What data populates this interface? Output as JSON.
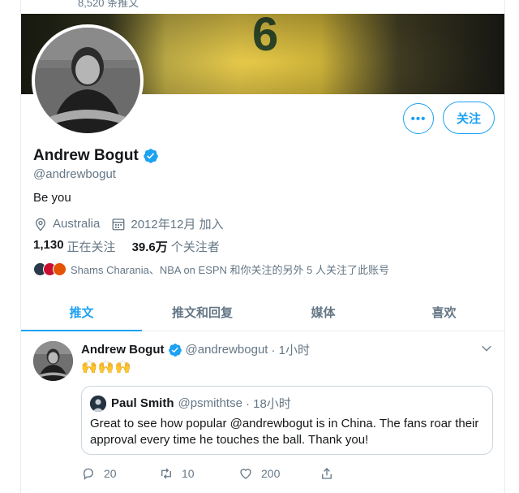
{
  "header": {
    "tweet_count": "8,520 条推文"
  },
  "profile": {
    "name": "Andrew Bogut",
    "handle": "@andrewbogut",
    "bio": "Be you",
    "location": "Australia",
    "joined": "2012年12月 加入",
    "jersey_number": "6",
    "more_button": "•••",
    "follow_button": "关注",
    "following_count": "1,130",
    "following_label": "正在关注",
    "followers_count": "39.6万",
    "followers_label": "个关注者",
    "followed_by_text": "Shams Charania、NBA on ESPN 和你关注的另外 5 人关注了此账号",
    "icons": [
      "verified-badge-icon",
      "location-pin-icon",
      "calendar-icon"
    ]
  },
  "tabs": [
    {
      "label": "推文",
      "active": true
    },
    {
      "label": "推文和回复",
      "active": false
    },
    {
      "label": "媒体",
      "active": false
    },
    {
      "label": "喜欢",
      "active": false
    }
  ],
  "tweet": {
    "author_name": "Andrew Bogut",
    "author_handle": "@andrewbogut",
    "time": "· 1小时",
    "text": "🙌🙌🙌",
    "quote": {
      "author_name": "Paul Smith",
      "author_handle": "@psmithtse",
      "time": "· 18小时",
      "text": "Great to see how popular @andrewbogut is in China.  The fans roar their approval every time he touches the ball.  Thank you!"
    },
    "replies": "20",
    "retweets": "10",
    "likes": "200"
  },
  "colors": {
    "accent": "#1da1f2",
    "text": "#14171a",
    "muted": "#657786",
    "border": "#e6ecf0"
  }
}
